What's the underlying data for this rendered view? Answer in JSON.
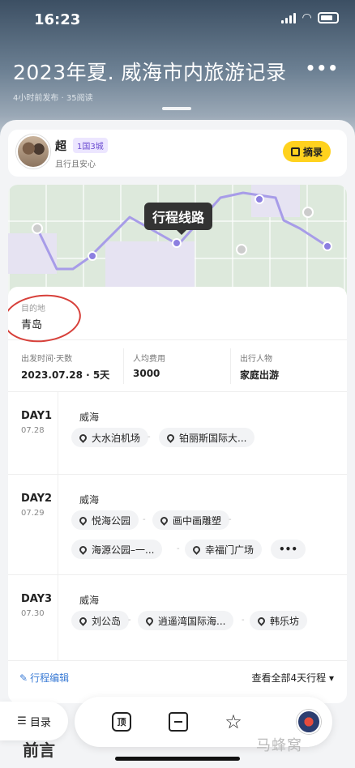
{
  "status": {
    "time": "16:23"
  },
  "header": {
    "title": "2023年夏. 威海市内旅游记录",
    "meta": "4小时前发布 · 35阅读",
    "more_icon": "more-icon"
  },
  "author": {
    "name": "超",
    "badge": "1国3城",
    "signature": "且行且安心",
    "excerpt_label": "摘录"
  },
  "map": {
    "label": "行程线路"
  },
  "destination": {
    "label": "目的地",
    "value": "青岛"
  },
  "info": [
    {
      "key": "出发时间·天数",
      "value": "2023.07.28 · 5天"
    },
    {
      "key": "人均费用",
      "value": "3000"
    },
    {
      "key": "出行人物",
      "value": "家庭出游"
    }
  ],
  "days": [
    {
      "name": "DAY1",
      "date": "07.28",
      "city": "威海",
      "stops": [
        "大水泊机场",
        "铂丽斯国际大..."
      ]
    },
    {
      "name": "DAY2",
      "date": "07.29",
      "city": "威海",
      "stops": [
        "悦海公园",
        "画中画雕塑",
        "海源公园–一...",
        "幸福门广场"
      ],
      "more": "•••"
    },
    {
      "name": "DAY3",
      "date": "07.30",
      "city": "威海",
      "stops": [
        "刘公岛",
        "逍遥湾国际海...",
        "韩乐坊"
      ]
    }
  ],
  "route_footer": {
    "edit": "行程编辑",
    "view_all": "查看全部4天行程 ▾"
  },
  "toolbar": {
    "toc": "目录",
    "top_icon": "顶"
  },
  "foreword": "前言",
  "watermark": "马蜂窝",
  "colors": {
    "accent_yellow": "#ffd21e",
    "link_blue": "#3a7bd5",
    "route_purple": "#8c7fe0"
  }
}
